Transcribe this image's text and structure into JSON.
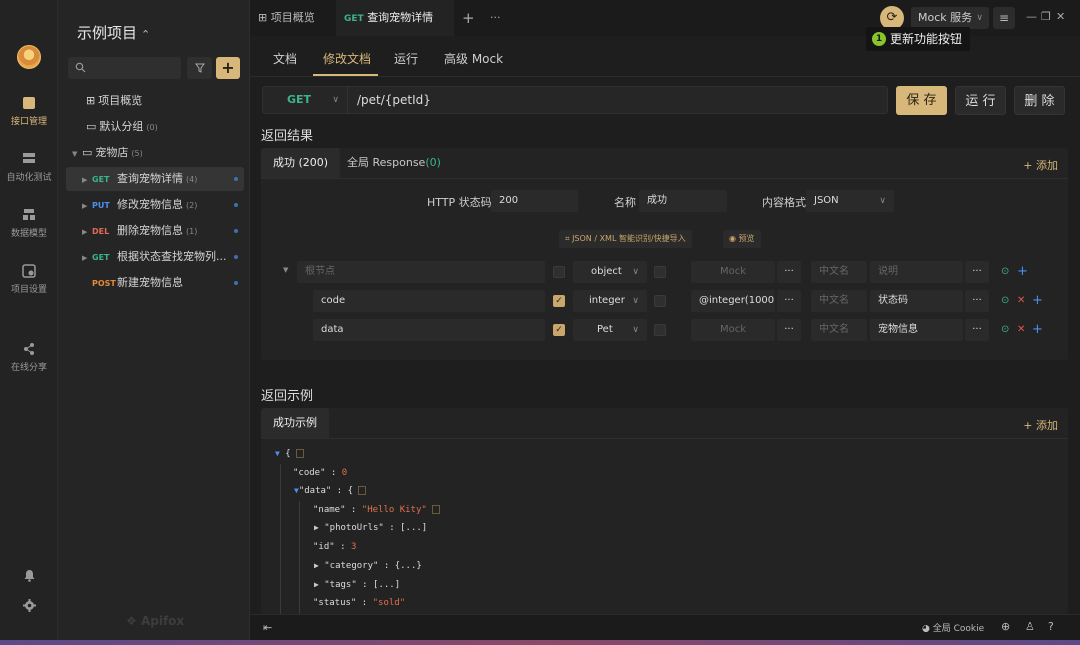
{
  "rail": {
    "items": [
      {
        "label": "接口管理",
        "icon": "api-management-icon"
      },
      {
        "label": "自动化测试",
        "icon": "automation-test-icon"
      },
      {
        "label": "数据模型",
        "icon": "data-model-icon"
      },
      {
        "label": "项目设置",
        "icon": "project-settings-icon"
      },
      {
        "label": "在线分享",
        "icon": "share-icon"
      }
    ]
  },
  "sidebar": {
    "project_title": "示例项目",
    "overview": "项目概览",
    "default_group": {
      "label": "默认分组",
      "count": "(0)"
    },
    "pet_store": {
      "label": "宠物店",
      "count": "(5)"
    },
    "endpoints": [
      {
        "method": "GET",
        "label": "查询宠物详情",
        "count": "(4)"
      },
      {
        "method": "PUT",
        "label": "修改宠物信息",
        "count": "(2)"
      },
      {
        "method": "DEL",
        "label": "删除宠物信息",
        "count": "(1)"
      },
      {
        "method": "GET",
        "label": "根据状态查找宠物列...",
        "count": ""
      },
      {
        "method": "POST",
        "label": "新建宠物信息",
        "count": ""
      }
    ],
    "watermark": "Apifox"
  },
  "tabbar": {
    "overview_tab": "项目概览",
    "active_tab_method": "GET",
    "active_tab_label": "查询宠物详情",
    "plus": "+",
    "more": "···",
    "mock_service": "Mock 服务",
    "tooltip_badge": "1",
    "tooltip_text": "更新功能按钮"
  },
  "subtabs": [
    "文档",
    "修改文档",
    "运行",
    "高级 Mock"
  ],
  "request": {
    "method": "GET",
    "path": "/pet/{petId}",
    "save": "保 存",
    "run": "运 行",
    "delete": "删 除"
  },
  "response": {
    "title": "返回结果",
    "tab_success": "成功 (200)",
    "tab_global": "全局 Response",
    "tab_global_count": "(0)",
    "add": "+ 添加",
    "http_status_label": "HTTP 状态码:",
    "http_status_value": "200",
    "name_label": "名称",
    "name_value": "成功",
    "format_label": "内容格式",
    "format_value": "JSON",
    "import_chip": "JSON / XML 智能识别/快捷导入",
    "preview_chip": "预览",
    "rows": [
      {
        "name": "根节点",
        "type": "object",
        "mock": "Mock",
        "cn": "中文名",
        "desc": "说明",
        "checked": false,
        "root": true
      },
      {
        "name": "code",
        "type": "integer",
        "mock": "@integer(1000",
        "cn": "中文名",
        "desc": "状态码",
        "checked": true,
        "root": false
      },
      {
        "name": "data",
        "type": "Pet",
        "mock": "Mock",
        "cn": "中文名",
        "desc": "宠物信息",
        "checked": true,
        "root": false
      }
    ],
    "more": "···"
  },
  "example": {
    "title": "返回示例",
    "tab": "成功示例",
    "add": "+ 添加",
    "lines": [
      {
        "text": "{",
        "indent": 0
      },
      {
        "key": "\"code\"",
        "value": "0",
        "indent": 1
      },
      {
        "key": "\"data\"",
        "value": "{",
        "indent": 1
      },
      {
        "key": "\"name\"",
        "value": "\"Hello Kity\"",
        "indent": 2
      },
      {
        "key": "\"photoUrls\"",
        "value": "[...]",
        "indent": 2
      },
      {
        "key": "\"id\"",
        "value": "3",
        "indent": 2
      },
      {
        "key": "\"category\"",
        "value": "{...}",
        "indent": 2
      },
      {
        "key": "\"tags\"",
        "value": "[...]",
        "indent": 2
      },
      {
        "key": "\"status\"",
        "value": "\"sold\"",
        "indent": 2
      }
    ]
  },
  "footer": {
    "cookie": "全局 Cookie"
  },
  "colors": {
    "accent": "#d8b77a",
    "get": "#3bb38e",
    "put": "#4b8ff0",
    "del": "#e06a53",
    "post": "#e58a3a"
  }
}
